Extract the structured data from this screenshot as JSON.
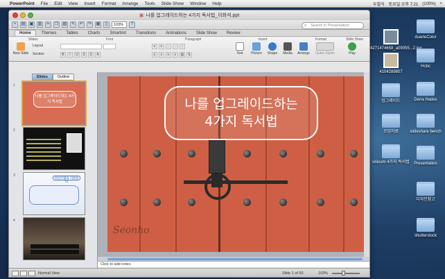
{
  "menubar": {
    "app": "PowerPoint",
    "items": [
      "File",
      "Edit",
      "View",
      "Insert",
      "Format",
      "Arrange",
      "Tools",
      "Slide Show",
      "Window",
      "Help"
    ],
    "status": {
      "input": "두벌식",
      "clock": "토요일 오후 7:21",
      "battery": "(100%)"
    }
  },
  "window": {
    "title": "나를 업그레이드하는 4가지 독서법_이화석.ppt",
    "zoom": "103%",
    "search_placeholder": "Search in Presentation"
  },
  "tabs": [
    "Home",
    "Themes",
    "Tables",
    "Charts",
    "SmartArt",
    "Transitions",
    "Animations",
    "Slide Show",
    "Review"
  ],
  "ribbon": {
    "groups": [
      "Slides",
      "Font",
      "Paragraph",
      "Insert",
      "Format",
      "Slide Show"
    ],
    "new_slide": "New Slide",
    "layout": "Layout",
    "section": "Section",
    "insert_buttons": [
      "Text",
      "Picture",
      "Shape",
      "Media"
    ],
    "arrange": "Arrange",
    "quick_styles": "Quick Styles",
    "play": "Play"
  },
  "pane": {
    "tabs": [
      "Slides",
      "Outline"
    ],
    "slide_numbers": [
      "1",
      "2",
      "3",
      "4"
    ],
    "thumb1_title": "나를 업그레이드하는 4가지 독서법",
    "thumb3_header": "마인드맵의 기본원리"
  },
  "slide": {
    "title_line1": "나를 업그레이드하는",
    "title_line2": "4가지 독서법",
    "watermark": "Seonho"
  },
  "notes_placeholder": "Click to add notes",
  "status": {
    "view": "Normal View",
    "slide_info": "Slide 1 of 50",
    "zoom": "103%"
  },
  "desktop": [
    {
      "label": "4271474658_a09055...2.jpg",
      "kind": "image"
    },
    {
      "label": "duarteColor",
      "kind": "folder"
    },
    {
      "label": "4104289807",
      "kind": "image"
    },
    {
      "label": "Hcbc",
      "kind": "folder"
    },
    {
      "label": "업그레이드",
      "kind": "folder"
    },
    {
      "label": "Dena Hades",
      "kind": "folder"
    },
    {
      "label": "모임자료",
      "kind": "folder"
    },
    {
      "label": "slideshare bench",
      "kind": "folder"
    },
    {
      "label": "unicum 4가지 독서법",
      "kind": "folder"
    },
    {
      "label": "Presentation",
      "kind": "folder"
    },
    {
      "label": "디자인참고",
      "kind": "folder"
    },
    {
      "label": "shutterstock",
      "kind": "folder"
    }
  ]
}
